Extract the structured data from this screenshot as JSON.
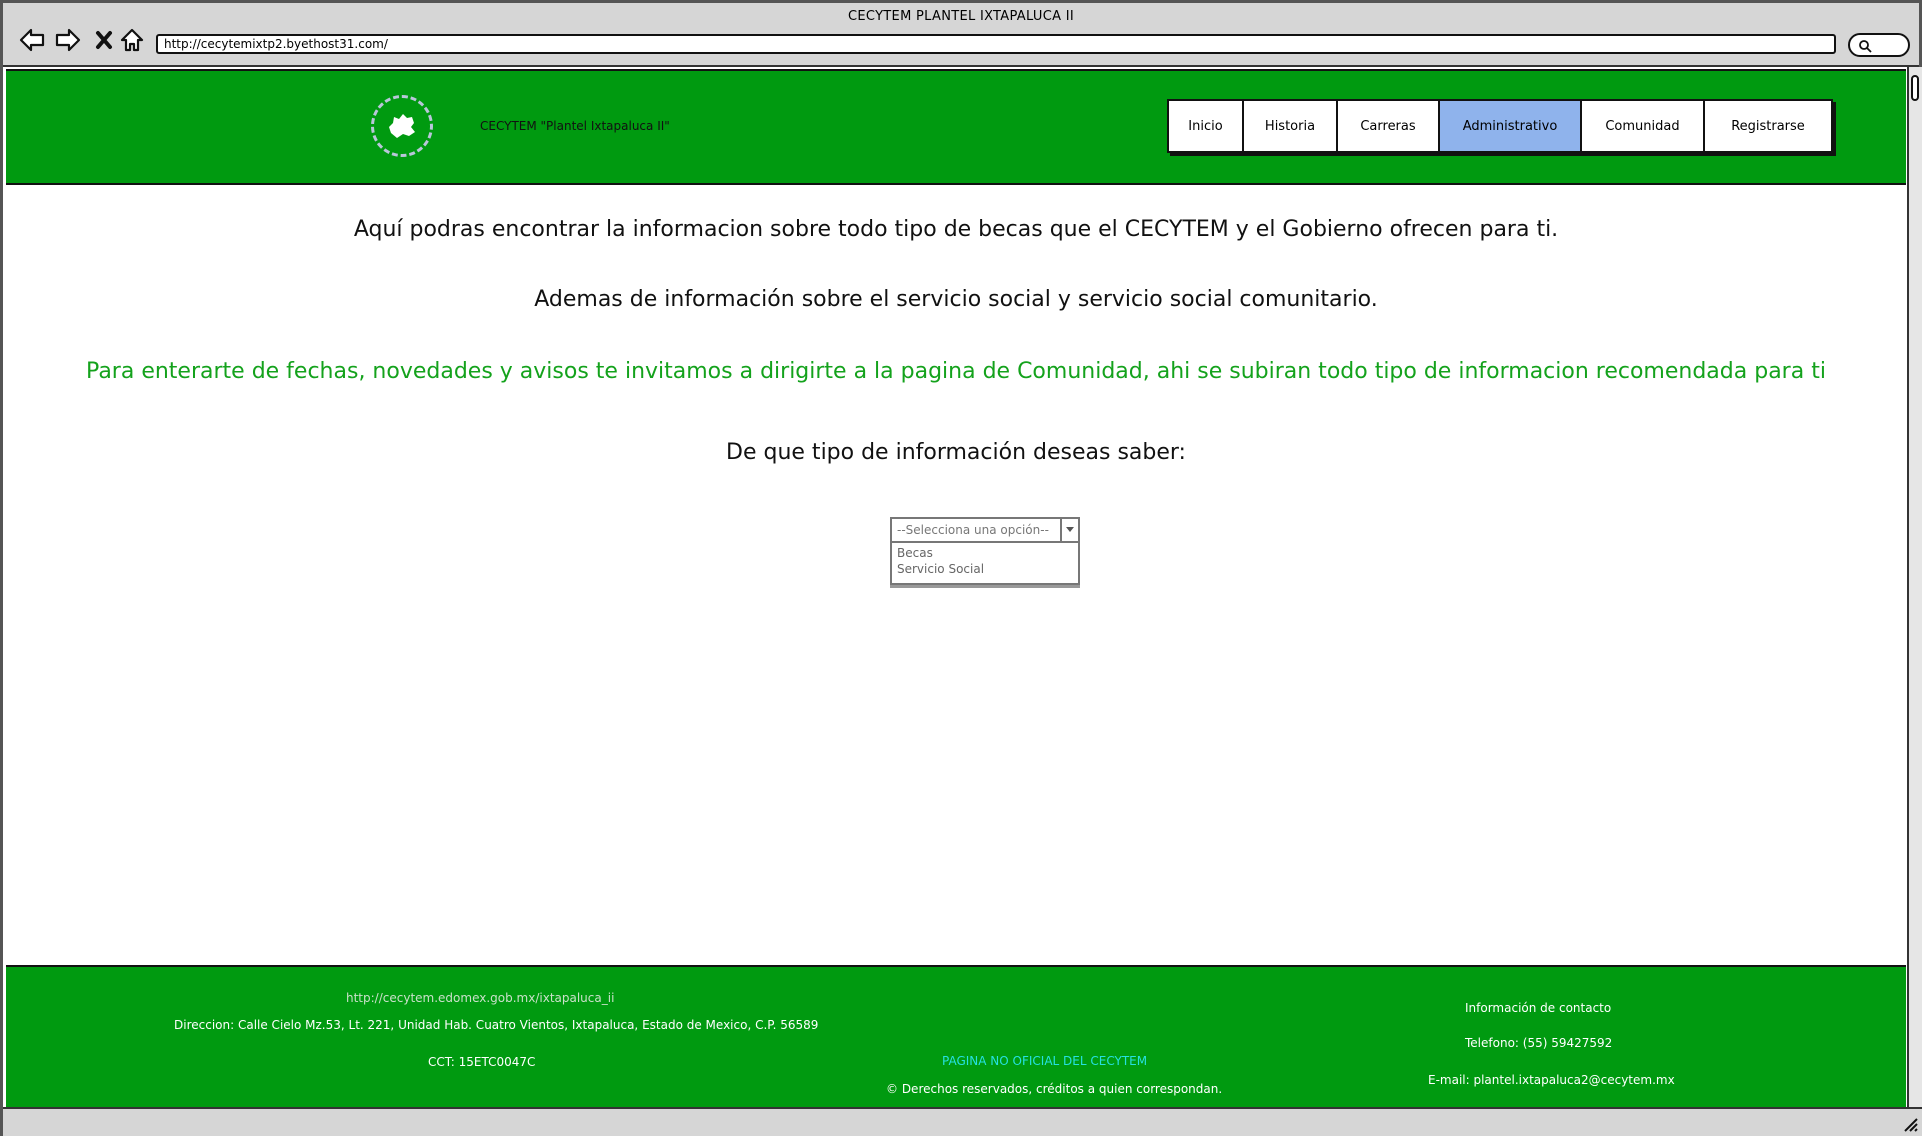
{
  "browser": {
    "window_title": "CECYTEM PLANTEL IXTAPALUCA II",
    "url": "http://cecytemixtp2.byethost31.com/"
  },
  "header": {
    "site_name": "CECYTEM \"Plantel Ixtapaluca II\"",
    "colors": {
      "header_bg": "#009a10",
      "active_tab": "#8fb3ec"
    },
    "menu": [
      {
        "label": "Inicio",
        "active": false
      },
      {
        "label": "Historia",
        "active": false
      },
      {
        "label": "Carreras",
        "active": false
      },
      {
        "label": "Administrativo",
        "active": true
      },
      {
        "label": "Comunidad",
        "active": false
      },
      {
        "label": "Registrarse",
        "active": false
      }
    ]
  },
  "main": {
    "intro": "Aquí podras encontrar la informacion sobre todo tipo de becas que el CECYTEM y el Gobierno ofrecen para ti.",
    "intro2": "Ademas de información sobre el servicio social y servicio social comunitario.",
    "notice": "Para enterarte de fechas, novedades y avisos te invitamos a dirigirte a la pagina de Comunidad, ahi se subiran todo tipo de informacion recomendada para ti",
    "question": "De que tipo de información deseas saber:",
    "select": {
      "placeholder": "--Selecciona una opción--",
      "options": [
        "Becas",
        "Servicio Social"
      ]
    }
  },
  "footer": {
    "link": "http://cecytem.edomex.gob.mx/ixtapaluca_ii",
    "address": "Direccion: Calle Cielo Mz.53, Lt. 221, Unidad Hab. Cuatro Vientos, Ixtapaluca, Estado de Mexico, C.P. 56589",
    "cct": "CCT: 15ETC0047C",
    "unofficial": "PAGINA NO OFICIAL DEL CECYTEM",
    "rights": "© Derechos reservados, créditos a quien correspondan.",
    "contact_title": "Información de contacto",
    "phone": "Telefono: (55) 59427592",
    "email": "E-mail: plantel.ixtapaluca2@cecytem.mx"
  }
}
